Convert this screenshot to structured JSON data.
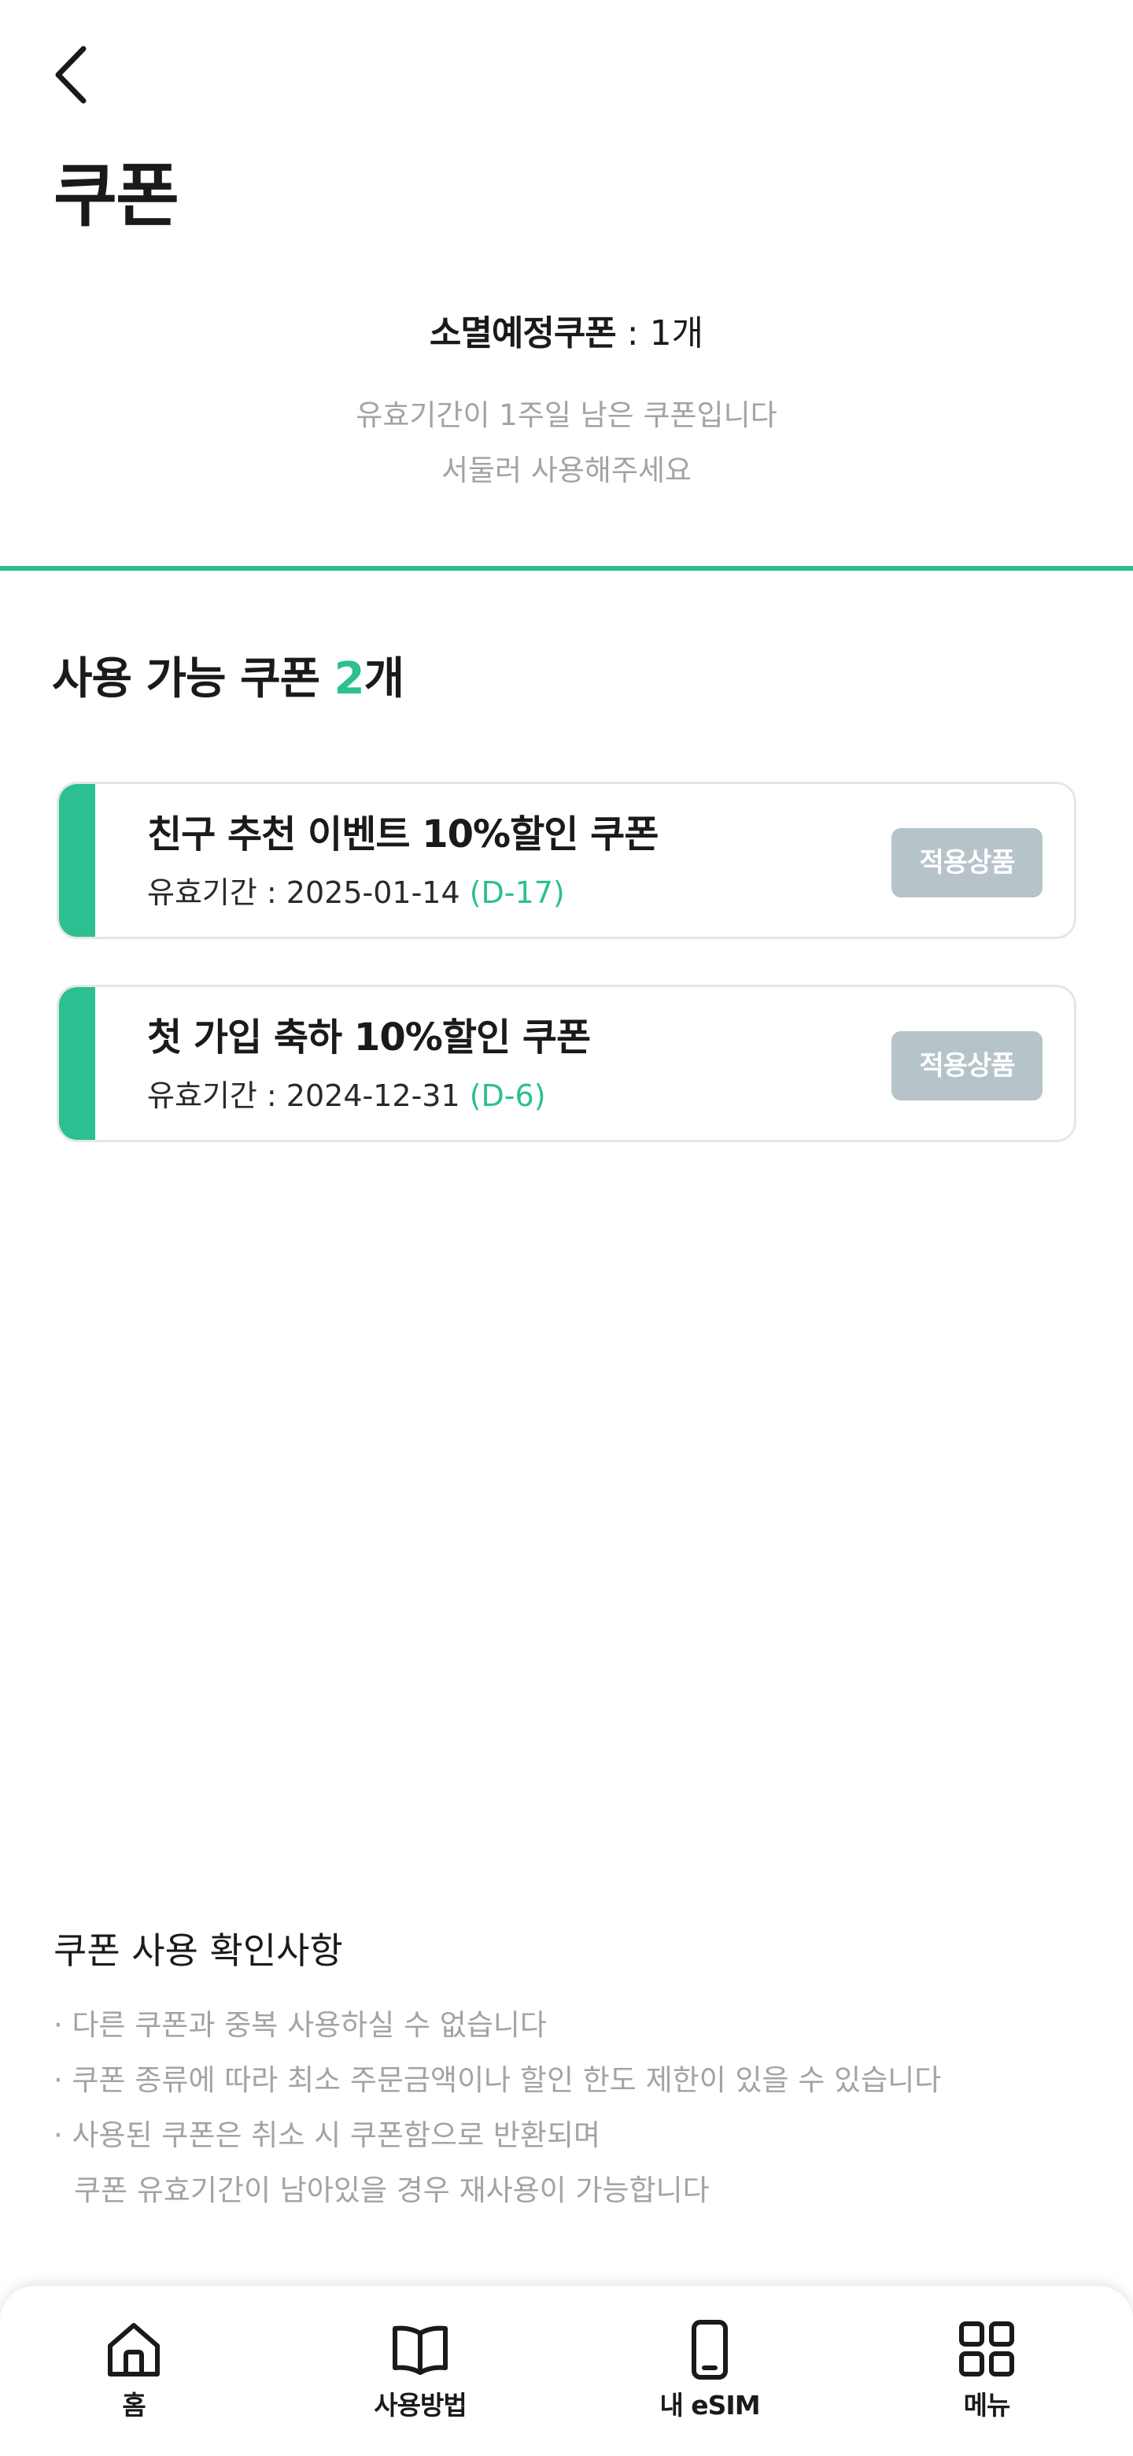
{
  "header": {
    "back_icon": "chevron-left-icon",
    "title": "쿠폰"
  },
  "expiring": {
    "label": "소멸예정쿠폰",
    "count_text": " : 1개",
    "note_line1": "유효기간이 1주일 남은 쿠폰입니다",
    "note_line2": "서둘러 사용해주세요"
  },
  "available": {
    "title_prefix": "사용 가능 쿠폰 ",
    "count": "2",
    "title_suffix": "개"
  },
  "coupons": [
    {
      "title": "친구 추천 이벤트 10%할인 쿠폰",
      "valid_text": "유효기간 : 2025-01-14 ",
      "dday": "(D-17)",
      "button": "적용상품"
    },
    {
      "title": "첫 가입 축하 10%할인 쿠폰",
      "valid_text": "유효기간 : 2024-12-31 ",
      "dday": "(D-6)",
      "button": "적용상품"
    }
  ],
  "notice": {
    "title": "쿠폰 사용 확인사항",
    "items": [
      "· 다른 쿠폰과 중복 사용하실 수 없습니다",
      "· 쿠폰 종류에 따라 최소 주문금액이나 할인 한도 제한이 있을 수 있습니다",
      "· 사용된 쿠폰은 취소 시 쿠폰함으로 반환되며",
      "쿠폰 유효기간이 남아있을 경우 재사용이 가능합니다"
    ]
  },
  "tabbar": {
    "items": [
      {
        "label": "홈",
        "icon": "home-icon"
      },
      {
        "label": "사용방법",
        "icon": "book-icon"
      },
      {
        "label": "내 eSIM",
        "icon": "phone-icon"
      },
      {
        "label": "메뉴",
        "icon": "grid-icon"
      }
    ]
  },
  "colors": {
    "accent": "#2bbf92",
    "button_gray": "#b6c4c9",
    "muted_text": "#a3a3a3"
  }
}
